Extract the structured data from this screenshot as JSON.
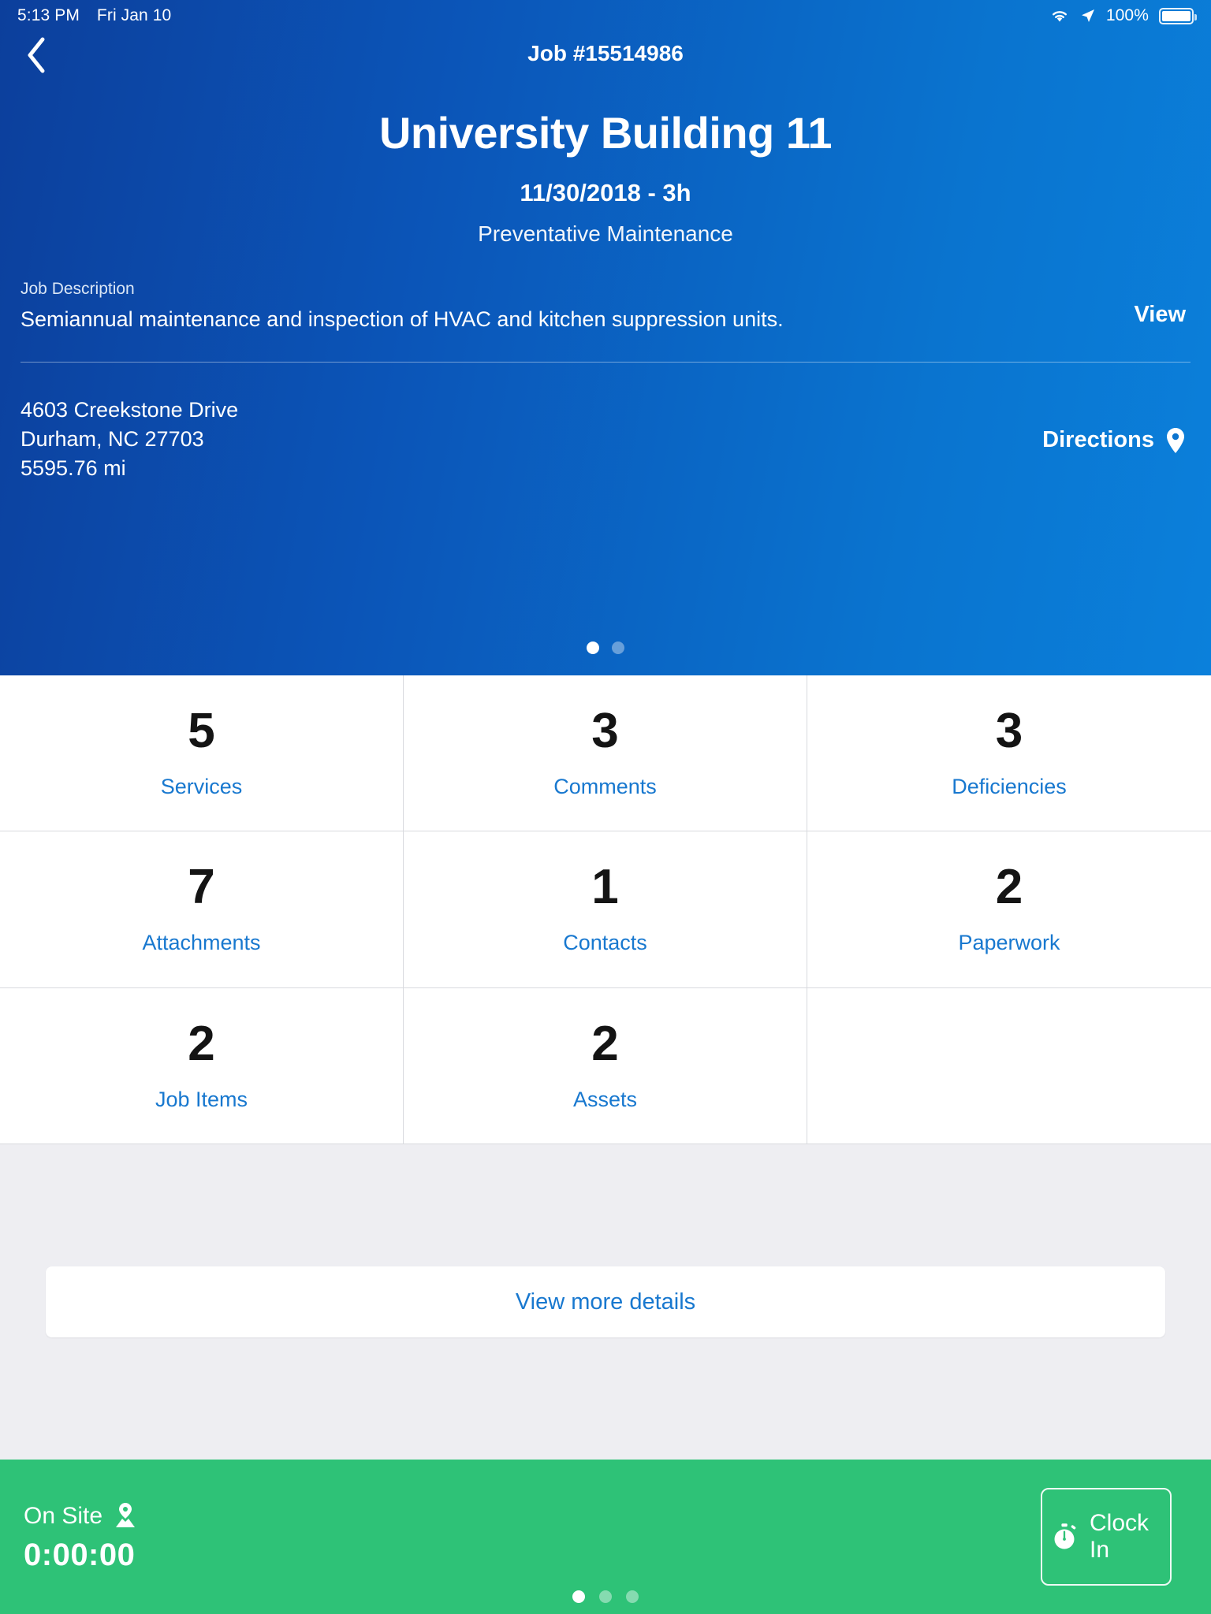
{
  "status_bar": {
    "time": "5:13 PM",
    "date": "Fri Jan 10",
    "battery_percent": "100%",
    "wifi_icon": "wifi-icon",
    "location_icon": "location-arrow-icon",
    "battery_icon": "battery-full-icon"
  },
  "header": {
    "back_icon": "chevron-left-icon",
    "job_number": "Job #15514986",
    "title": "University Building 11",
    "date_duration": "11/30/2018 - 3h",
    "job_type": "Preventative Maintenance",
    "description_label": "Job Description",
    "description_text": "Semiannual maintenance and inspection of HVAC and kitchen suppression units.",
    "view_label": "View",
    "address_line1": "4603 Creekstone Drive",
    "address_line2": "Durham, NC 27703",
    "distance": "5595.76 mi",
    "directions_label": "Directions",
    "directions_icon": "map-pin-icon",
    "pager": {
      "count": 2,
      "active": 0
    }
  },
  "stats": [
    {
      "count": "5",
      "label": "Services"
    },
    {
      "count": "3",
      "label": "Comments"
    },
    {
      "count": "3",
      "label": "Deficiencies"
    },
    {
      "count": "7",
      "label": "Attachments"
    },
    {
      "count": "1",
      "label": "Contacts"
    },
    {
      "count": "2",
      "label": "Paperwork"
    },
    {
      "count": "2",
      "label": "Job Items"
    },
    {
      "count": "2",
      "label": "Assets"
    },
    {
      "count": "",
      "label": ""
    }
  ],
  "details": {
    "button_label": "View more details"
  },
  "footer": {
    "on_site_label": "On Site",
    "on_site_icon": "map-marker-icon",
    "timer": "0:00:00",
    "clock_in_label": "Clock In",
    "clock_in_icon": "stopwatch-icon",
    "pager": {
      "count": 3,
      "active": 0
    }
  },
  "colors": {
    "brand_blue": "#0b55b8",
    "link_blue": "#1878cf",
    "footer_green": "#2ec277",
    "band_gray": "#eeeef2"
  }
}
